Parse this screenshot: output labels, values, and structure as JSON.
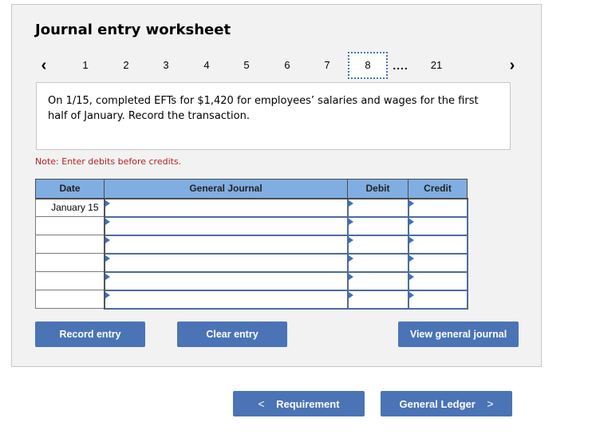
{
  "worksheet": {
    "title": "Journal entry worksheet",
    "pager": {
      "prev_icon": "‹",
      "next_icon": "›",
      "pages": [
        "1",
        "2",
        "3",
        "4",
        "5",
        "6",
        "7",
        "8"
      ],
      "active_page": "8",
      "ellipsis": "....",
      "last_page": "21"
    },
    "prompt": "On 1/15, completed EFTs for $1,420 for employees’ salaries and wages for the first half of January. Record the transaction.",
    "note": "Note: Enter debits before credits.",
    "table": {
      "headers": {
        "date": "Date",
        "journal": "General Journal",
        "debit": "Debit",
        "credit": "Credit"
      },
      "rows": [
        {
          "date": "January 15",
          "journal": "",
          "debit": "",
          "credit": ""
        },
        {
          "date": "",
          "journal": "",
          "debit": "",
          "credit": ""
        },
        {
          "date": "",
          "journal": "",
          "debit": "",
          "credit": ""
        },
        {
          "date": "",
          "journal": "",
          "debit": "",
          "credit": ""
        },
        {
          "date": "",
          "journal": "",
          "debit": "",
          "credit": ""
        },
        {
          "date": "",
          "journal": "",
          "debit": "",
          "credit": ""
        }
      ]
    },
    "buttons": {
      "record": "Record entry",
      "clear": "Clear entry",
      "view_journal": "View general journal"
    }
  },
  "navigation": {
    "prev_label": "Requirement",
    "prev_icon": "<",
    "next_label": "General Ledger",
    "next_icon": ">"
  },
  "colors": {
    "accent": "#4a74b5",
    "header_bg": "#80aee3",
    "note_red": "#b22222",
    "panel_bg": "#f2f2f2"
  }
}
